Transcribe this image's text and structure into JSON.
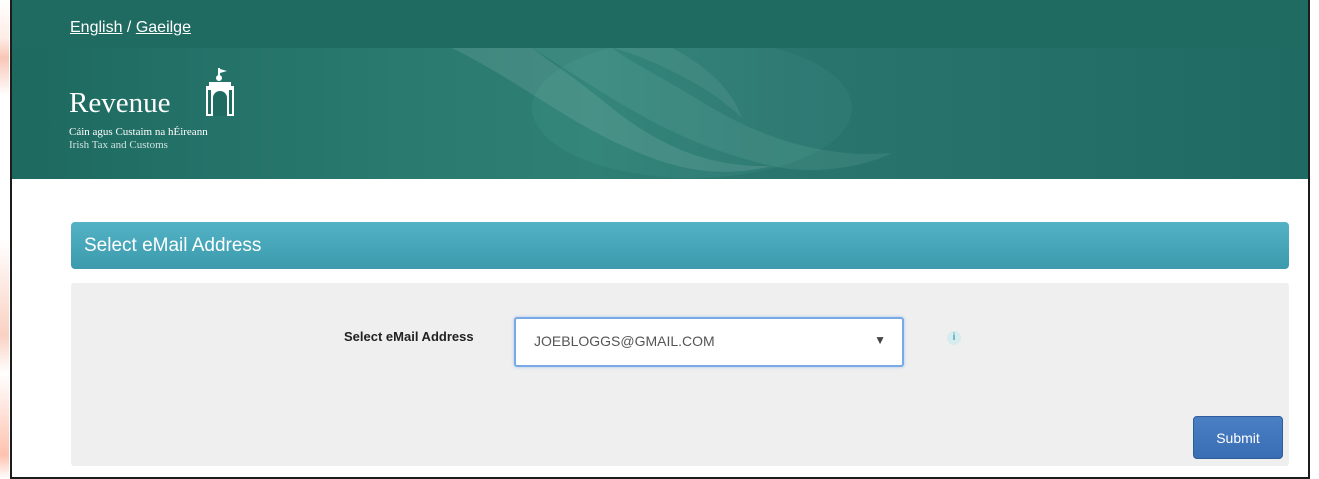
{
  "lang": {
    "english": "English",
    "separator": " / ",
    "gaeilge": "Gaeilge"
  },
  "brand": {
    "name": "Revenue",
    "line1": "Cáin agus Custaim na hÉireann",
    "line2": "Irish Tax and Customs"
  },
  "section": {
    "title": "Select eMail Address"
  },
  "form": {
    "label": "Select eMail Address",
    "selected_value": "JOEBLOGGS@GMAIL.COM",
    "info_glyph": "i",
    "submit_label": "Submit"
  },
  "colors": {
    "header_bg": "#1f6a61",
    "section_bar": "#47a6b9",
    "panel_bg": "#efefef",
    "button_bg": "#3a6eb4"
  }
}
